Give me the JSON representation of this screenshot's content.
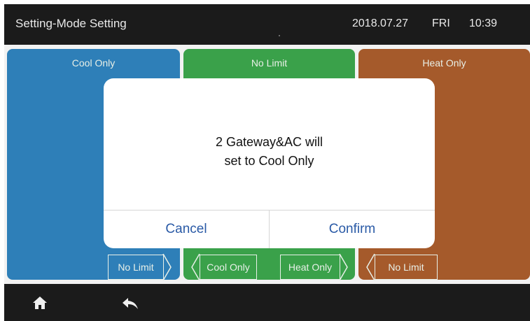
{
  "header": {
    "title": "Setting-Mode Setting",
    "date": "2018.07.27",
    "day": "FRI",
    "time": "10:39"
  },
  "panels": [
    {
      "title": "Cool Only",
      "color": "#2e7fb8",
      "button": "No Limit"
    },
    {
      "title": "No Limit",
      "color": "#3aa14a",
      "buttons": [
        "Cool Only",
        "Heat Only"
      ]
    },
    {
      "title": "Heat Only",
      "color": "#a55a2b",
      "button": "No Limit"
    }
  ],
  "dialog": {
    "message_line1": "2 Gateway&AC will",
    "message_line2": "set to Cool Only",
    "cancel_label": "Cancel",
    "confirm_label": "Confirm",
    "button_color": "#2a5aa6"
  },
  "footer": {
    "icons": [
      "home-icon",
      "back-icon"
    ]
  }
}
